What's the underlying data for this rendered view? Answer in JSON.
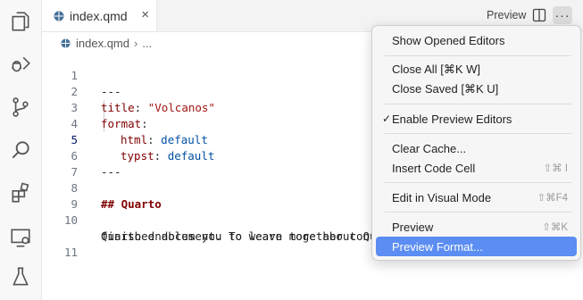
{
  "tab": {
    "label": "index.qmd",
    "close": "×"
  },
  "toolbar": {
    "preview_label": "Preview",
    "more": "···"
  },
  "breadcrumb": {
    "file": "index.qmd",
    "sep": "›",
    "more": "..."
  },
  "editor": {
    "lines": [
      {
        "n": "1",
        "t": "---"
      },
      {
        "n": "2",
        "key": "title",
        "val": "\"Volcanos\""
      },
      {
        "n": "3",
        "key": "format"
      },
      {
        "n": "4",
        "key": "html",
        "val": "default"
      },
      {
        "n": "5",
        "key": "typst",
        "val": "default"
      },
      {
        "n": "6",
        "t": "---"
      },
      {
        "n": "7"
      },
      {
        "n": "8",
        "t": "## Quarto"
      },
      {
        "n": "9"
      },
      {
        "n": "10",
        "t": "Quarto enables you to weave together conte",
        "t2": "finished document. To learn more about Qua"
      },
      {
        "n": "11"
      }
    ]
  },
  "menu": {
    "items": [
      {
        "label": "Show Opened Editors"
      },
      {
        "label": "Close All",
        "shortcut": "[⌘K W]"
      },
      {
        "label": "Close Saved",
        "shortcut": "[⌘K U]"
      },
      {
        "label": "Enable Preview Editors",
        "check": "✓"
      },
      {
        "label": "Clear Cache..."
      },
      {
        "label": "Insert Code Cell",
        "kb": "⇧⌘ I"
      },
      {
        "label": "Edit in Visual Mode",
        "kb": "⇧⌘F4"
      },
      {
        "label": "Preview",
        "kb": "⇧⌘K"
      },
      {
        "label": "Preview Format..."
      }
    ]
  },
  "colors": {
    "accent": "#5b8df2",
    "tab_active": "#ffffff"
  }
}
